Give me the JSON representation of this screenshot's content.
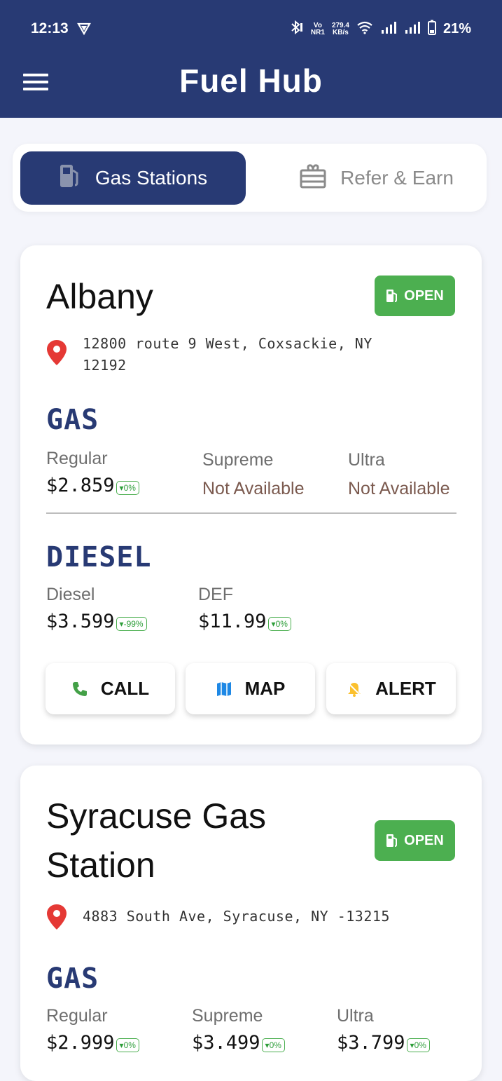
{
  "status_bar": {
    "time": "12:13",
    "net_top": "Vo",
    "net_bottom": "NR1",
    "speed_top": "279.4",
    "speed_bottom": "KB/s",
    "battery": "21%"
  },
  "header": {
    "title": "Fuel Hub"
  },
  "tabs": [
    {
      "label": "Gas Stations",
      "active": true,
      "icon": "gas-pump-icon"
    },
    {
      "label": "Refer & Earn",
      "active": false,
      "icon": "gift-icon"
    }
  ],
  "stations": [
    {
      "name": "Albany",
      "status": "OPEN",
      "address": "12800 route 9 West, Coxsackie, NY 12192",
      "gas_title": "GAS",
      "gas": [
        {
          "label": "Regular",
          "price": "$2.859",
          "change": "0%"
        },
        {
          "label": "Supreme",
          "price": "Not Available"
        },
        {
          "label": "Ultra",
          "price": "Not Available"
        }
      ],
      "diesel_title": "DIESEL",
      "diesel": [
        {
          "label": "Diesel",
          "price": "$3.599",
          "change": "-99%"
        },
        {
          "label": "DEF",
          "price": "$11.99",
          "change": "0%"
        }
      ],
      "actions": {
        "call": "CALL",
        "map": "MAP",
        "alert": "ALERT"
      }
    },
    {
      "name": "Syracuse Gas Station",
      "status": "OPEN",
      "address": "4883 South Ave, Syracuse, NY -13215",
      "gas_title": "GAS",
      "gas": [
        {
          "label": "Regular",
          "price": "$2.999",
          "change": "0%"
        },
        {
          "label": "Supreme",
          "price": "$3.499",
          "change": "0%"
        },
        {
          "label": "Ultra",
          "price": "$3.799",
          "change": "0%"
        }
      ]
    }
  ],
  "colors": {
    "primary": "#283a74",
    "open_green": "#4caf50",
    "pin_red": "#e53935",
    "phone_green": "#43a047",
    "map_blue": "#1e88e5",
    "bell_yellow": "#fbc02d"
  }
}
